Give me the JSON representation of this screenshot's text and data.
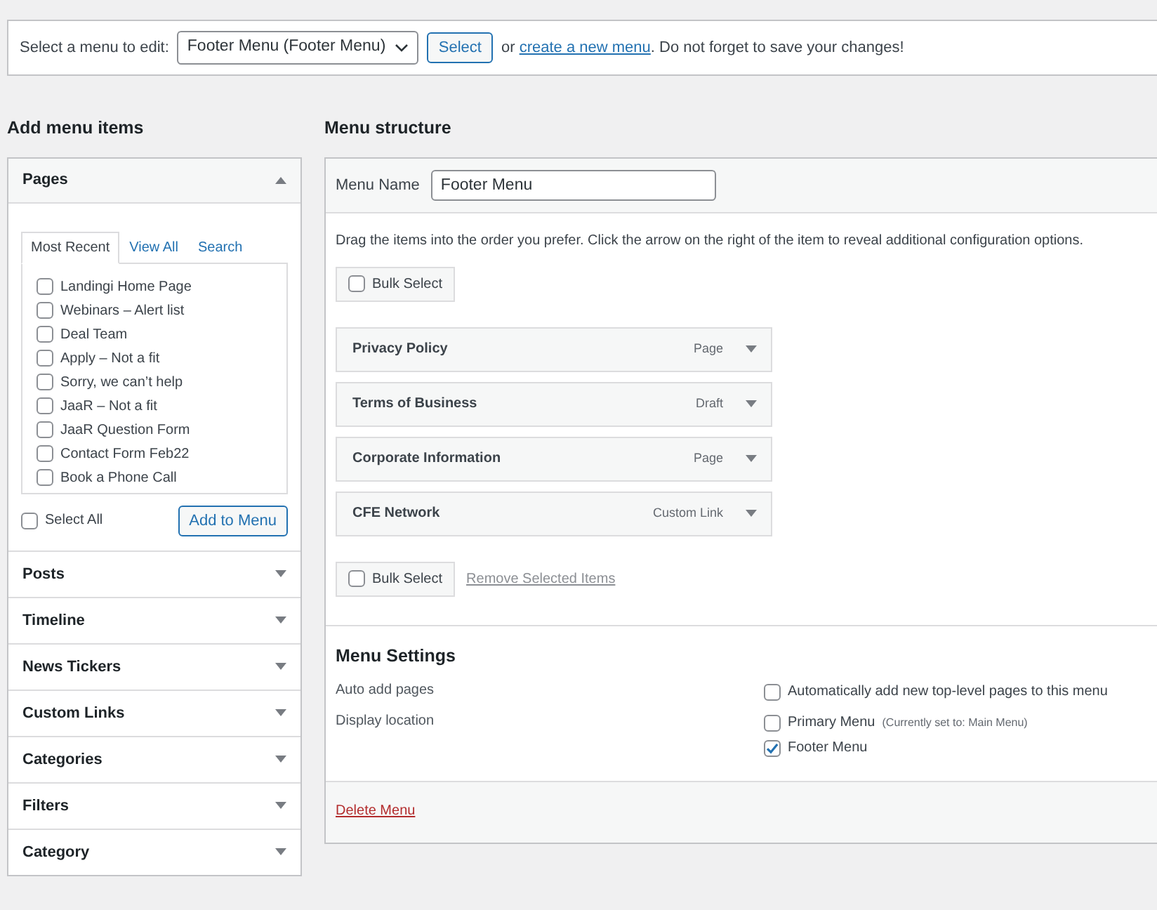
{
  "menu_selector": {
    "label": "Select a menu to edit:",
    "value": "Footer Menu (Footer Menu)",
    "button": "Select",
    "text_before_link": "or",
    "link": "create a new menu",
    "text_after_link": ". Do not forget to save your changes!"
  },
  "add_menu_items": {
    "heading": "Add menu items",
    "sections": [
      {
        "title": "Pages",
        "expanded": true,
        "tabs": [
          {
            "label": "Most Recent",
            "selected": true
          },
          {
            "label": "View All",
            "selected": false
          },
          {
            "label": "Search",
            "selected": false
          }
        ],
        "items": [
          {
            "label": "Landingi Home Page",
            "checked": false
          },
          {
            "label": "Webinars – Alert list",
            "checked": false
          },
          {
            "label": "Deal Team",
            "checked": false
          },
          {
            "label": "Apply – Not a fit",
            "checked": false
          },
          {
            "label": "Sorry, we can’t help",
            "checked": false
          },
          {
            "label": "JaaR – Not a fit",
            "checked": false
          },
          {
            "label": "JaaR Question Form",
            "checked": false
          },
          {
            "label": "Contact Form Feb22",
            "checked": false
          },
          {
            "label": "Book a Phone Call",
            "checked": false
          }
        ],
        "select_all": {
          "label": "Select All",
          "checked": false
        },
        "add_button": "Add to Menu"
      },
      {
        "title": "Posts",
        "expanded": false
      },
      {
        "title": "Timeline",
        "expanded": false
      },
      {
        "title": "News Tickers",
        "expanded": false
      },
      {
        "title": "Custom Links",
        "expanded": false
      },
      {
        "title": "Categories",
        "expanded": false
      },
      {
        "title": "Filters",
        "expanded": false
      },
      {
        "title": "Category",
        "expanded": false
      }
    ]
  },
  "menu_structure": {
    "heading": "Menu structure",
    "name_label": "Menu Name",
    "name_value": "Footer Menu",
    "instructions": "Drag the items into the order you prefer. Click the arrow on the right of the item to reveal additional configuration options.",
    "bulk_select_top": {
      "label": "Bulk Select",
      "checked": false
    },
    "items": [
      {
        "title": "Privacy Policy",
        "type": "Page"
      },
      {
        "title": "Terms of Business",
        "type": "Draft"
      },
      {
        "title": "Corporate Information",
        "type": "Page"
      },
      {
        "title": "CFE Network",
        "type": "Custom Link"
      }
    ],
    "bulk_select_bottom": {
      "label": "Bulk Select",
      "checked": false
    },
    "remove_selected": "Remove Selected Items",
    "settings": {
      "heading": "Menu Settings",
      "rows": [
        {
          "label": "Auto add pages",
          "options": [
            {
              "label": "Automatically add new top-level pages to this menu",
              "checked": false
            }
          ]
        },
        {
          "label": "Display location",
          "options": [
            {
              "label": "Primary Menu",
              "note": "(Currently set to: Main Menu)",
              "checked": false
            },
            {
              "label": "Footer Menu",
              "checked": true
            }
          ]
        }
      ]
    },
    "delete_link": "Delete Menu"
  }
}
